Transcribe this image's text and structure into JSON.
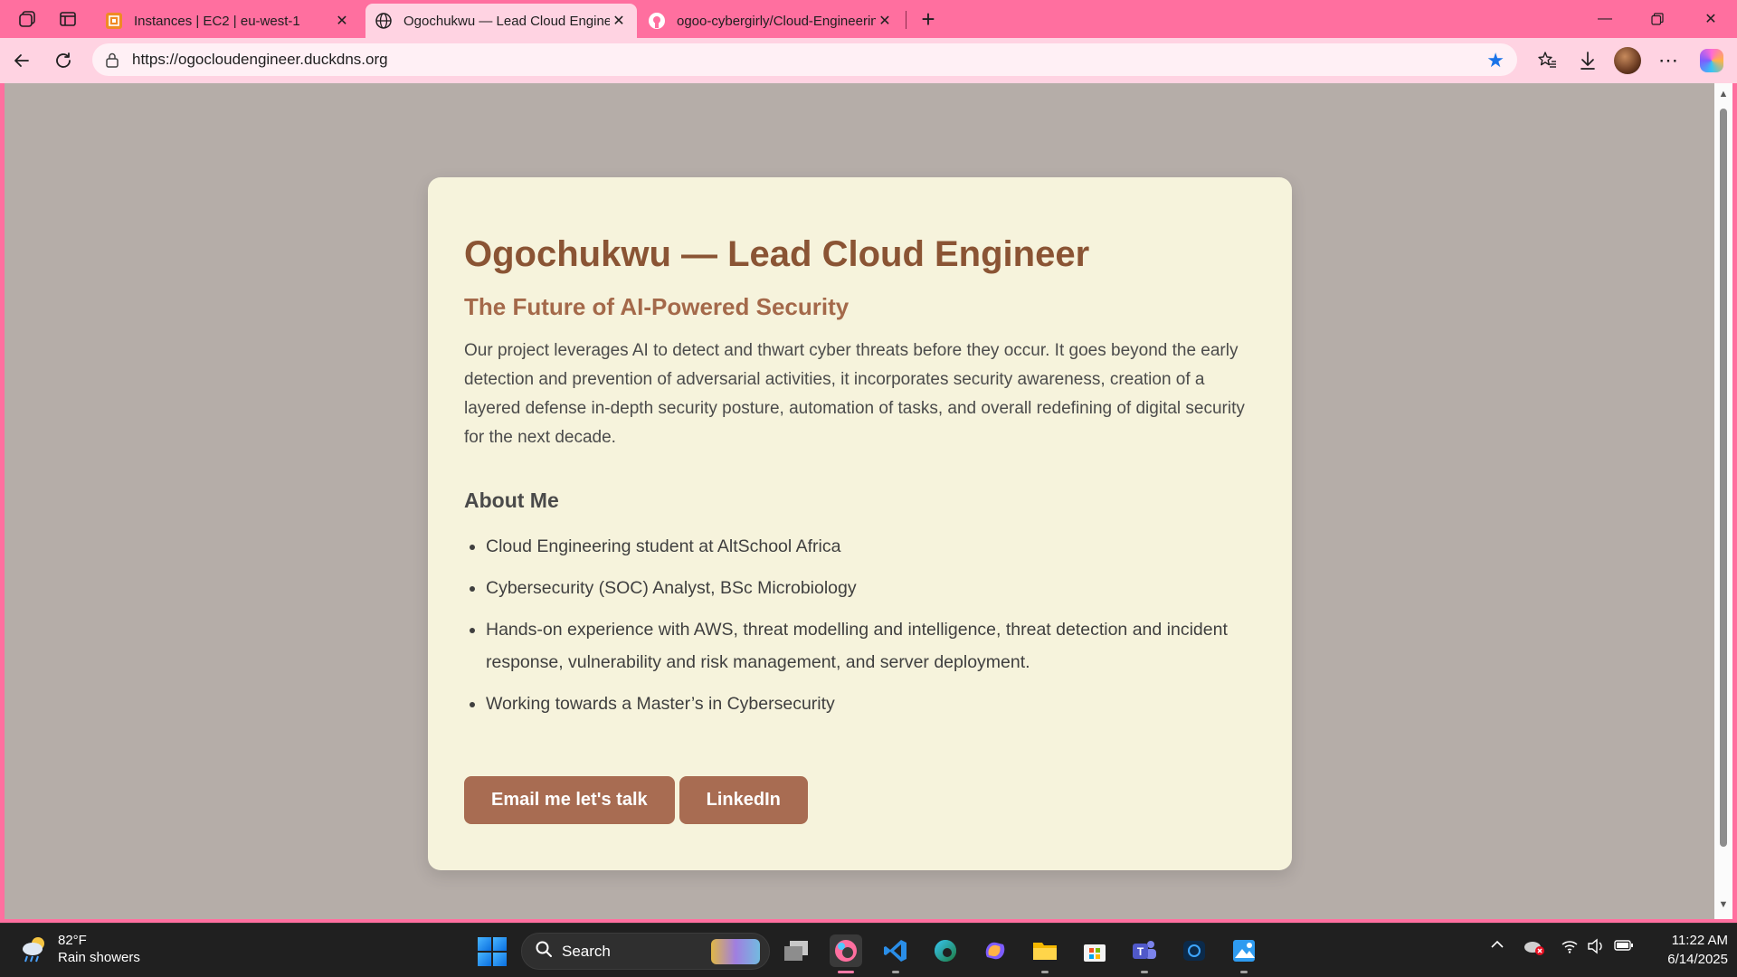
{
  "browser": {
    "tabs": [
      {
        "title": "Instances | EC2 | eu-west-1",
        "favicon": "aws-ec2-icon",
        "active": false
      },
      {
        "title": "Ogochukwu — Lead Cloud Engineer",
        "favicon": "globe-icon",
        "active": true
      },
      {
        "title": "ogoo-cybergirly/Cloud-Engineering",
        "favicon": "github-icon",
        "active": false
      }
    ],
    "address": "https://ogocloudengineer.duckdns.org",
    "bookmarked": true
  },
  "page": {
    "title": "Ogochukwu — Lead Cloud Engineer",
    "subtitle": "The Future of AI-Powered Security",
    "intro": "Our project leverages AI to detect and thwart cyber threats before they occur. It goes beyond the early detection and prevention of adversarial activities, it incorporates security awareness, creation of a layered defense in-depth security posture, automation of tasks, and overall redefining of digital security for the next decade.",
    "about_heading": "About Me",
    "about_items": [
      "Cloud Engineering student at AltSchool Africa",
      "Cybersecurity (SOC) Analyst, BSc Microbiology",
      "Hands-on experience with AWS, threat modelling and intelligence, threat detection and incident response, vulnerability and risk management, and server deployment.",
      "Working towards a Master’s in Cybersecurity"
    ],
    "buttons": {
      "email": "Email me let's talk",
      "linkedin": "LinkedIn"
    }
  },
  "taskbar": {
    "weather_temp": "82°F",
    "weather_desc": "Rain showers",
    "search_placeholder": "Search",
    "time": "11:22 AM",
    "date": "6/14/2025"
  },
  "colors": {
    "tab_strip": "#ff6f9f",
    "toolbar": "#ffd3e2",
    "page_bg": "#b5ada8",
    "card_bg": "#f6f3dc",
    "heading": "#8a5434",
    "subheading": "#a4694a",
    "button": "#a86c52"
  }
}
